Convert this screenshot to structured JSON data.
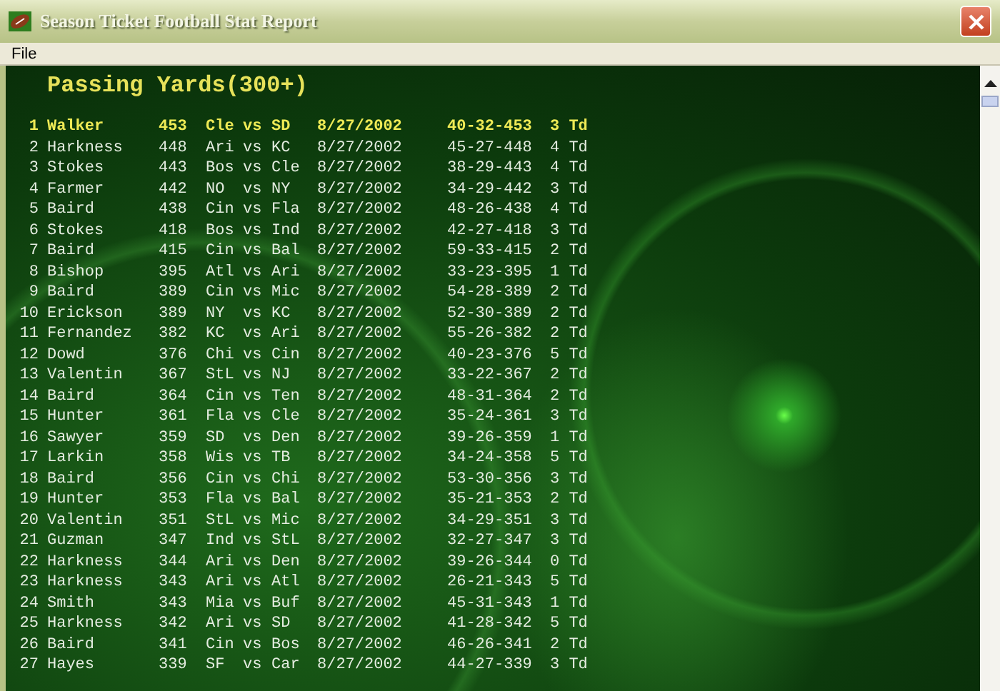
{
  "window": {
    "title": "Season Ticket Football Stat Report"
  },
  "menu": [
    {
      "label": "File"
    }
  ],
  "report": {
    "title": "Passing Yards(300+)",
    "rows": [
      {
        "rank": "1",
        "name": "Walker",
        "yards": "453",
        "team": "Cle",
        "vs": "vs",
        "opponent": "SD",
        "date": "8/27/2002",
        "line": "40-32-453",
        "td": "3 Td",
        "selected": true
      },
      {
        "rank": "2",
        "name": "Harkness",
        "yards": "448",
        "team": "Ari",
        "vs": "vs",
        "opponent": "KC",
        "date": "8/27/2002",
        "line": "45-27-448",
        "td": "4 Td",
        "selected": false
      },
      {
        "rank": "3",
        "name": "Stokes",
        "yards": "443",
        "team": "Bos",
        "vs": "vs",
        "opponent": "Cle",
        "date": "8/27/2002",
        "line": "38-29-443",
        "td": "4 Td",
        "selected": false
      },
      {
        "rank": "4",
        "name": "Farmer",
        "yards": "442",
        "team": "NO",
        "vs": "vs",
        "opponent": "NY",
        "date": "8/27/2002",
        "line": "34-29-442",
        "td": "3 Td",
        "selected": false
      },
      {
        "rank": "5",
        "name": "Baird",
        "yards": "438",
        "team": "Cin",
        "vs": "vs",
        "opponent": "Fla",
        "date": "8/27/2002",
        "line": "48-26-438",
        "td": "4 Td",
        "selected": false
      },
      {
        "rank": "6",
        "name": "Stokes",
        "yards": "418",
        "team": "Bos",
        "vs": "vs",
        "opponent": "Ind",
        "date": "8/27/2002",
        "line": "42-27-418",
        "td": "3 Td",
        "selected": false
      },
      {
        "rank": "7",
        "name": "Baird",
        "yards": "415",
        "team": "Cin",
        "vs": "vs",
        "opponent": "Bal",
        "date": "8/27/2002",
        "line": "59-33-415",
        "td": "2 Td",
        "selected": false
      },
      {
        "rank": "8",
        "name": "Bishop",
        "yards": "395",
        "team": "Atl",
        "vs": "vs",
        "opponent": "Ari",
        "date": "8/27/2002",
        "line": "33-23-395",
        "td": "1 Td",
        "selected": false
      },
      {
        "rank": "9",
        "name": "Baird",
        "yards": "389",
        "team": "Cin",
        "vs": "vs",
        "opponent": "Mic",
        "date": "8/27/2002",
        "line": "54-28-389",
        "td": "2 Td",
        "selected": false
      },
      {
        "rank": "10",
        "name": "Erickson",
        "yards": "389",
        "team": "NY",
        "vs": "vs",
        "opponent": "KC",
        "date": "8/27/2002",
        "line": "52-30-389",
        "td": "2 Td",
        "selected": false
      },
      {
        "rank": "11",
        "name": "Fernandez",
        "yards": "382",
        "team": "KC",
        "vs": "vs",
        "opponent": "Ari",
        "date": "8/27/2002",
        "line": "55-26-382",
        "td": "2 Td",
        "selected": false
      },
      {
        "rank": "12",
        "name": "Dowd",
        "yards": "376",
        "team": "Chi",
        "vs": "vs",
        "opponent": "Cin",
        "date": "8/27/2002",
        "line": "40-23-376",
        "td": "5 Td",
        "selected": false
      },
      {
        "rank": "13",
        "name": "Valentin",
        "yards": "367",
        "team": "StL",
        "vs": "vs",
        "opponent": "NJ",
        "date": "8/27/2002",
        "line": "33-22-367",
        "td": "2 Td",
        "selected": false
      },
      {
        "rank": "14",
        "name": "Baird",
        "yards": "364",
        "team": "Cin",
        "vs": "vs",
        "opponent": "Ten",
        "date": "8/27/2002",
        "line": "48-31-364",
        "td": "2 Td",
        "selected": false
      },
      {
        "rank": "15",
        "name": "Hunter",
        "yards": "361",
        "team": "Fla",
        "vs": "vs",
        "opponent": "Cle",
        "date": "8/27/2002",
        "line": "35-24-361",
        "td": "3 Td",
        "selected": false
      },
      {
        "rank": "16",
        "name": "Sawyer",
        "yards": "359",
        "team": "SD",
        "vs": "vs",
        "opponent": "Den",
        "date": "8/27/2002",
        "line": "39-26-359",
        "td": "1 Td",
        "selected": false
      },
      {
        "rank": "17",
        "name": "Larkin",
        "yards": "358",
        "team": "Wis",
        "vs": "vs",
        "opponent": "TB",
        "date": "8/27/2002",
        "line": "34-24-358",
        "td": "5 Td",
        "selected": false
      },
      {
        "rank": "18",
        "name": "Baird",
        "yards": "356",
        "team": "Cin",
        "vs": "vs",
        "opponent": "Chi",
        "date": "8/27/2002",
        "line": "53-30-356",
        "td": "3 Td",
        "selected": false
      },
      {
        "rank": "19",
        "name": "Hunter",
        "yards": "353",
        "team": "Fla",
        "vs": "vs",
        "opponent": "Bal",
        "date": "8/27/2002",
        "line": "35-21-353",
        "td": "2 Td",
        "selected": false
      },
      {
        "rank": "20",
        "name": "Valentin",
        "yards": "351",
        "team": "StL",
        "vs": "vs",
        "opponent": "Mic",
        "date": "8/27/2002",
        "line": "34-29-351",
        "td": "3 Td",
        "selected": false
      },
      {
        "rank": "21",
        "name": "Guzman",
        "yards": "347",
        "team": "Ind",
        "vs": "vs",
        "opponent": "StL",
        "date": "8/27/2002",
        "line": "32-27-347",
        "td": "3 Td",
        "selected": false
      },
      {
        "rank": "22",
        "name": "Harkness",
        "yards": "344",
        "team": "Ari",
        "vs": "vs",
        "opponent": "Den",
        "date": "8/27/2002",
        "line": "39-26-344",
        "td": "0 Td",
        "selected": false
      },
      {
        "rank": "23",
        "name": "Harkness",
        "yards": "343",
        "team": "Ari",
        "vs": "vs",
        "opponent": "Atl",
        "date": "8/27/2002",
        "line": "26-21-343",
        "td": "5 Td",
        "selected": false
      },
      {
        "rank": "24",
        "name": "Smith",
        "yards": "343",
        "team": "Mia",
        "vs": "vs",
        "opponent": "Buf",
        "date": "8/27/2002",
        "line": "45-31-343",
        "td": "1 Td",
        "selected": false
      },
      {
        "rank": "25",
        "name": "Harkness",
        "yards": "342",
        "team": "Ari",
        "vs": "vs",
        "opponent": "SD",
        "date": "8/27/2002",
        "line": "41-28-342",
        "td": "5 Td",
        "selected": false
      },
      {
        "rank": "26",
        "name": "Baird",
        "yards": "341",
        "team": "Cin",
        "vs": "vs",
        "opponent": "Bos",
        "date": "8/27/2002",
        "line": "46-26-341",
        "td": "2 Td",
        "selected": false
      },
      {
        "rank": "27",
        "name": "Hayes",
        "yards": "339",
        "team": "SF",
        "vs": "vs",
        "opponent": "Car",
        "date": "8/27/2002",
        "line": "44-27-339",
        "td": "3 Td",
        "selected": false
      }
    ]
  }
}
